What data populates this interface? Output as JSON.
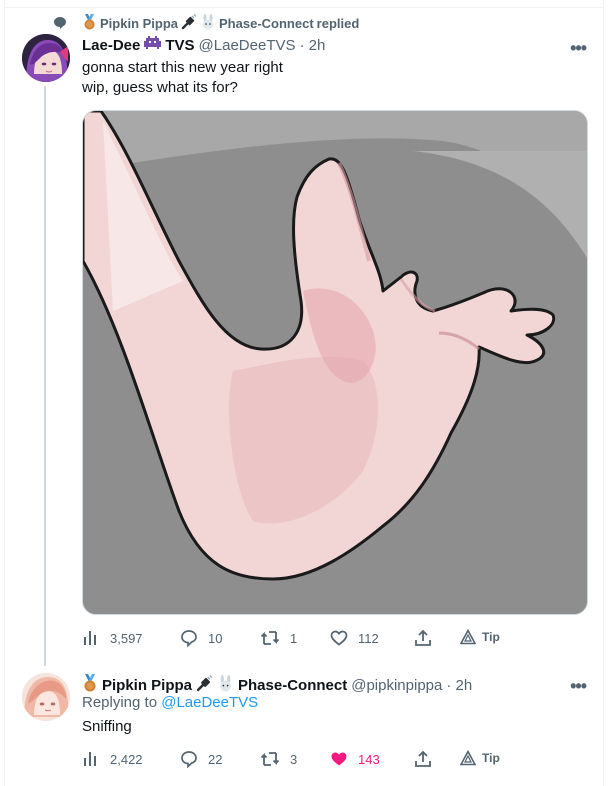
{
  "social_context": {
    "first": "Pipkin Pippa",
    "second": "Phase-Connect",
    "suffix": "replied"
  },
  "tweet1": {
    "name_a": "Lae-Dee",
    "name_b": "TVS",
    "handle": "@LaeDeeTVS",
    "time": "· 2h",
    "line1": "gonna start this new year right",
    "line2": "wip, guess what its for?",
    "views": "3,597",
    "replies": "10",
    "retweets": "1",
    "likes": "112",
    "tip": "Tip"
  },
  "tweet2": {
    "name": "Pipkin Pippa",
    "name_suffix": "Phase-Connect",
    "handle": "@pipkinpippa",
    "time": "· 2h",
    "replying_prefix": "Replying to",
    "replying_to": "@LaeDeeTVS",
    "text": "Sniffing",
    "views": "2,422",
    "replies": "22",
    "retweets": "3",
    "likes": "143",
    "tip": "Tip"
  },
  "colors": {
    "accent": "#1d9bf0",
    "like": "#f91880",
    "secondary_text": "#536471"
  }
}
